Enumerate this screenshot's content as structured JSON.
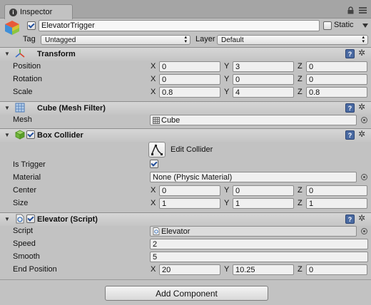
{
  "tab": {
    "label": "Inspector",
    "icon": "info-icon"
  },
  "header": {
    "name": "ElevatorTrigger",
    "active": true,
    "static_label": "Static",
    "static_checked": false,
    "tag_label": "Tag",
    "tag_value": "Untagged",
    "layer_label": "Layer",
    "layer_value": "Default"
  },
  "transform": {
    "title": "Transform",
    "rows": [
      {
        "label": "Position",
        "x": "0",
        "y": "3",
        "z": "0"
      },
      {
        "label": "Rotation",
        "x": "0",
        "y": "0",
        "z": "0"
      },
      {
        "label": "Scale",
        "x": "0.8",
        "y": "4",
        "z": "0.8"
      }
    ]
  },
  "mesh_filter": {
    "title": "Cube (Mesh Filter)",
    "mesh_label": "Mesh",
    "mesh_value": "Cube"
  },
  "box_collider": {
    "title": "Box Collider",
    "enabled": true,
    "edit_label": "Edit Collider",
    "is_trigger_label": "Is Trigger",
    "is_trigger": true,
    "material_label": "Material",
    "material_value": "None (Physic Material)",
    "center_label": "Center",
    "center": {
      "x": "0",
      "y": "0",
      "z": "0"
    },
    "size_label": "Size",
    "size": {
      "x": "1",
      "y": "1",
      "z": "1"
    }
  },
  "elevator": {
    "title": "Elevator (Script)",
    "enabled": true,
    "script_label": "Script",
    "script_value": "Elevator",
    "speed_label": "Speed",
    "speed_value": "2",
    "smooth_label": "Smooth",
    "smooth_value": "5",
    "end_label": "End Position",
    "end": {
      "x": "20",
      "y": "10.25",
      "z": "0"
    }
  },
  "axis": {
    "x": "X",
    "y": "Y",
    "z": "Z"
  },
  "add_component_label": "Add Component",
  "colors": {
    "background": "#c2c2c2",
    "tab_bar": "#a5a5a5",
    "help_blue": "#4a6aa2",
    "check_blue": "#214d9a"
  }
}
